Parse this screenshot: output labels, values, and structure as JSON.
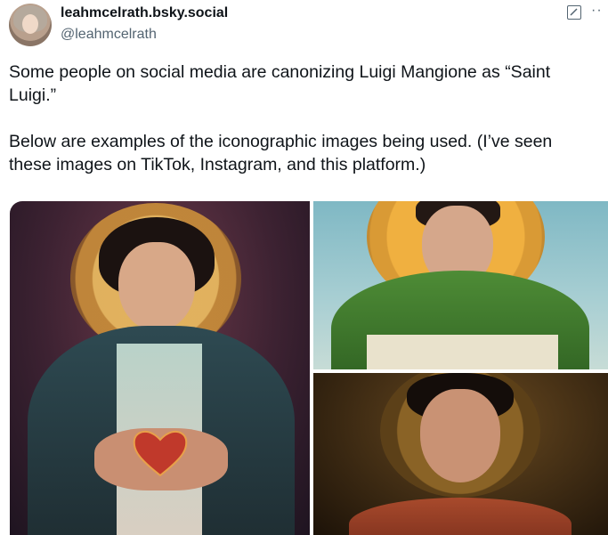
{
  "post": {
    "display_name": "leahmcelrath.bsky.social",
    "handle": "@leahmcelrath",
    "more_label": "··",
    "text": "Some people on social media are canonizing Luigi Mangione as “Saint Luigi.”\n\nBelow are examples of the iconographic images being used. (I’ve seen these images on TikTok, Instagram, and this platform.)"
  },
  "icons": {
    "avatar": "avatar",
    "edit": "edit-icon",
    "more": "more-icon"
  },
  "colors": {
    "text": "#0f1419",
    "secondary_text": "#536471",
    "halo_gold": "#d9a441",
    "heart_red": "#c0392b",
    "cloak_green": "#3f7a2c"
  }
}
